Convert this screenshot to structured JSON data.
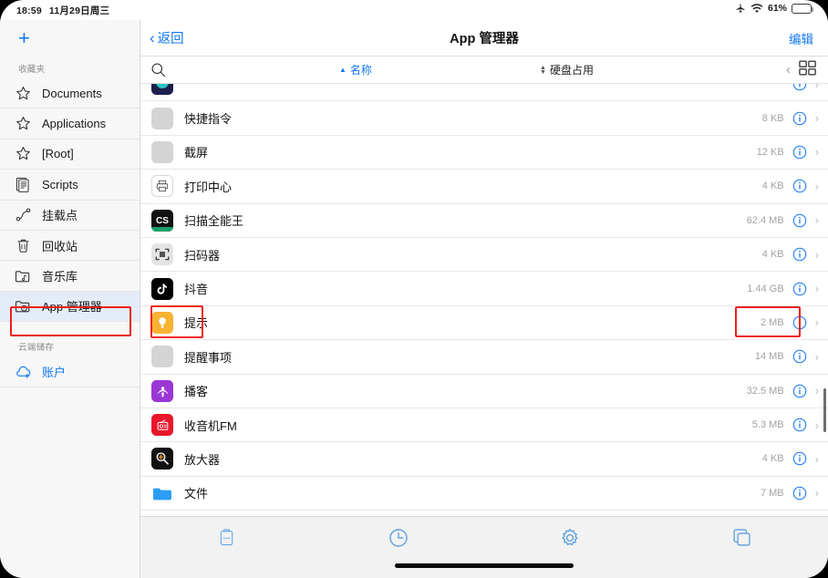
{
  "statusbar": {
    "time": "18:59",
    "date": "11月29日周三",
    "airplane_icon": "airplane-icon",
    "wifi_icon": "wifi-icon",
    "battery_percent": "61%",
    "battery_charging": true
  },
  "sidebar": {
    "add_label": "+",
    "sections": [
      {
        "title": "收藏夹",
        "items": [
          {
            "label": "Documents",
            "icon": "star-icon"
          },
          {
            "label": "Applications",
            "icon": "star-icon"
          },
          {
            "label": "[Root]",
            "icon": "star-icon"
          },
          {
            "label": "Scripts",
            "icon": "script-icon"
          },
          {
            "label": "挂载点",
            "icon": "mountpoint-icon"
          },
          {
            "label": "回收站",
            "icon": "trash-icon"
          },
          {
            "label": "音乐库",
            "icon": "music-folder-icon"
          },
          {
            "label": "App 管理器",
            "icon": "app-folder-icon",
            "selected": true,
            "highlighted": true
          }
        ]
      },
      {
        "title": "云端储存",
        "items": [
          {
            "label": "账户",
            "icon": "cloud-plus-icon",
            "accent": true
          }
        ]
      }
    ]
  },
  "navbar": {
    "back_label": "返回",
    "title": "App 管理器",
    "edit_label": "编辑"
  },
  "sortbar": {
    "search_icon": "search-icon",
    "sort_name_label": "名称",
    "sort_name_active": true,
    "sort_name_direction": "asc",
    "sort_size_label": "硬盘占用",
    "sort_size_active": false,
    "collapse_icon": "chevron-left-icon",
    "view_toggle_icon": "grid-view-icon"
  },
  "list": {
    "rows": [
      {
        "name": "",
        "size": "",
        "icon": "navy-app-icon",
        "partial": true
      },
      {
        "name": "快捷指令",
        "size": "8 KB",
        "icon": "placeholder-icon"
      },
      {
        "name": "截屏",
        "size": "12 KB",
        "icon": "placeholder-icon"
      },
      {
        "name": "打印中心",
        "size": "4 KB",
        "icon": "printer-icon"
      },
      {
        "name": "扫描全能王",
        "size": "62.4 MB",
        "icon": "camscanner-icon"
      },
      {
        "name": "扫码器",
        "size": "4 KB",
        "icon": "qr-scanner-icon"
      },
      {
        "name": "抖音",
        "size": "1.44 GB",
        "icon": "tiktok-icon"
      },
      {
        "name": "提示",
        "size": "2 MB",
        "icon": "tips-icon",
        "highlighted": true
      },
      {
        "name": "提醒事项",
        "size": "14 MB",
        "icon": "placeholder-icon"
      },
      {
        "name": "播客",
        "size": "32.5 MB",
        "icon": "podcasts-icon"
      },
      {
        "name": "收音机FM",
        "size": "5.3 MB",
        "icon": "radio-icon"
      },
      {
        "name": "放大器",
        "size": "4 KB",
        "icon": "magnifier-icon"
      },
      {
        "name": "文件",
        "size": "7 MB",
        "icon": "files-icon"
      },
      {
        "name": "",
        "size": "",
        "icon": "placeholder-icon",
        "partial": true
      }
    ],
    "info_icon": "info-circle-icon",
    "disclosure_icon": "chevron-right-icon"
  },
  "tabbar": {
    "tabs": [
      {
        "icon": "clipboard-icon"
      },
      {
        "icon": "clock-icon"
      },
      {
        "icon": "gear-icon"
      },
      {
        "icon": "windows-copy-icon"
      }
    ]
  },
  "colors": {
    "accent_blue": "#1277f0",
    "highlight_red": "#f01d1d",
    "selected_row_bg": "#e4edf7",
    "battery_green": "#30d158"
  }
}
